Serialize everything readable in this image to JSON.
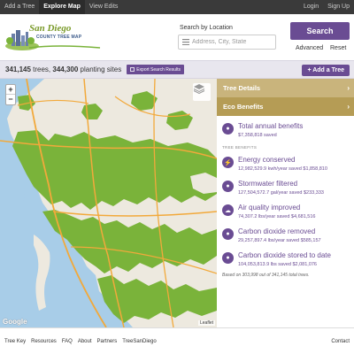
{
  "nav": {
    "left": [
      "Add a Tree",
      "Explore Map",
      "View Edits"
    ],
    "right": [
      "Login",
      "Sign Up"
    ]
  },
  "logo": {
    "line1": "San Diego",
    "line2": "COUNTY TREE MAP"
  },
  "search": {
    "label": "Search by Location",
    "placeholder": "Address, City, State",
    "button": "Search",
    "advanced": "Advanced",
    "reset": "Reset"
  },
  "stats": {
    "trees": "341,145",
    "trees_suffix": " trees, ",
    "sites": "344,300",
    "sites_suffix": " planting sites",
    "export_label": "Export Search Results",
    "add_tree_label": "+ Add a Tree"
  },
  "map": {
    "zoom_in": "+",
    "zoom_out": "−",
    "google": "Google",
    "attribution": "Leaflet"
  },
  "sidebar": {
    "tree_details": "Tree Details",
    "eco_benefits": "Eco Benefits",
    "total_label": "Total annual benefits",
    "total_value": "$7,358,818 saved",
    "section_title": "TREE BENEFITS",
    "benefits": [
      {
        "icon": "lightning-icon",
        "glyph": "⚡",
        "label": "Energy conserved",
        "value": "12,982,529.9 kwh/year saved $1,858,810"
      },
      {
        "icon": "water-drop-icon",
        "glyph": "●",
        "label": "Stormwater filtered",
        "value": "127,504,572.7 gal/year saved $233,333"
      },
      {
        "icon": "cloud-icon",
        "glyph": "☁",
        "label": "Air quality improved",
        "value": "74,307.2 lbs/year saved $4,681,516"
      },
      {
        "icon": "co2-icon",
        "glyph": "●",
        "label": "Carbon dioxide removed",
        "value": "29,257,897.4 lbs/year saved $585,157"
      },
      {
        "icon": "co2-stored-icon",
        "glyph": "●",
        "label": "Carbon dioxide stored to date",
        "value": "104,053,813.9 lbs saved $2,081,076"
      }
    ],
    "note": "Based on 303,998 out of 341,145 total trees."
  },
  "footer": {
    "links": [
      "Tree Key",
      "Resources",
      "FAQ",
      "About",
      "Partners",
      "TreeSanDiego"
    ],
    "contact": "Contact"
  },
  "colors": {
    "brand_purple": "#6a4c93",
    "tree_green": "#7ab33a",
    "ocean": "#a8cde8",
    "panel_gold": "#c9b47c"
  }
}
